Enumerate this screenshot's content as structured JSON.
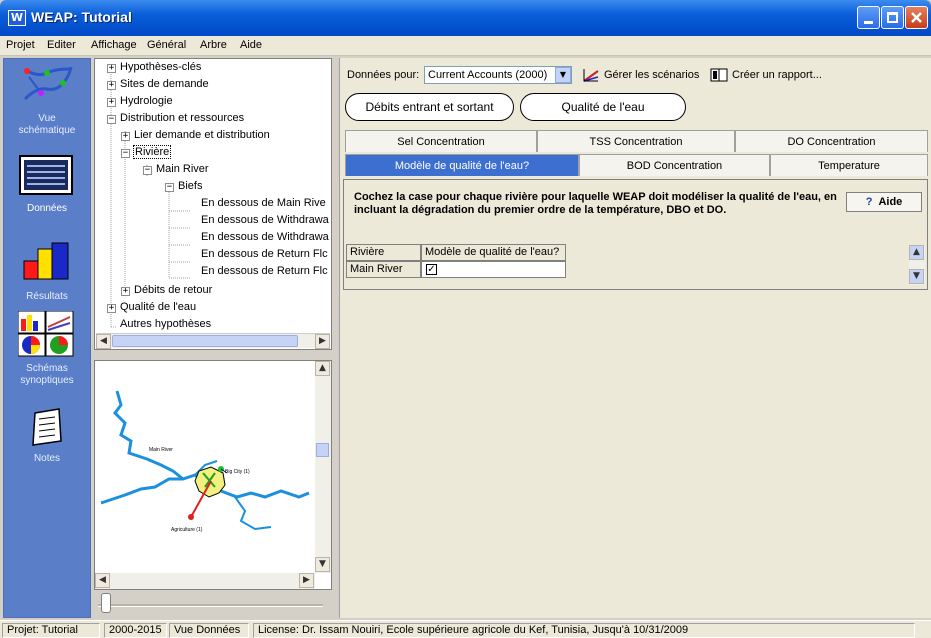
{
  "window": {
    "title": "WEAP: Tutorial",
    "app_icon": "W"
  },
  "menu": [
    "Projet",
    "Editer",
    "Affichage",
    "Général",
    "Arbre",
    "Aide"
  ],
  "leftnav": {
    "items": [
      {
        "label": "Vue\nschématique",
        "icon": "schematic-icon"
      },
      {
        "label": "Données",
        "icon": "data-icon"
      },
      {
        "label": "Résultats",
        "icon": "results-icon"
      },
      {
        "label": "Schémas\nsynoptiques",
        "icon": "overviews-icon"
      },
      {
        "label": "Notes",
        "icon": "notes-icon"
      }
    ]
  },
  "tree": {
    "items": [
      {
        "label": "Hypothèses-clés",
        "level": 0,
        "toggle": "+"
      },
      {
        "label": "Sites de demande",
        "level": 0,
        "toggle": "+"
      },
      {
        "label": "Hydrologie",
        "level": 0,
        "toggle": "+"
      },
      {
        "label": "Distribution et ressources",
        "level": 0,
        "toggle": "-"
      },
      {
        "label": "Lier demande et distribution",
        "level": 1,
        "toggle": "+"
      },
      {
        "label": "Rivière",
        "level": 1,
        "toggle": "-",
        "selected": true
      },
      {
        "label": "Main River",
        "level": 2,
        "toggle": "-"
      },
      {
        "label": "Biefs",
        "level": 3,
        "toggle": "-"
      },
      {
        "label": "En dessous de Main Rive",
        "level": 4
      },
      {
        "label": "En dessous de Withdrawa",
        "level": 4
      },
      {
        "label": "En dessous de Withdrawa",
        "level": 4
      },
      {
        "label": "En dessous de Return Flc",
        "level": 4
      },
      {
        "label": "En dessous de Return Flc",
        "level": 4
      },
      {
        "label": "Débits de retour",
        "level": 1,
        "toggle": "+"
      },
      {
        "label": "Qualité de l'eau",
        "level": 0,
        "toggle": "+"
      },
      {
        "label": "Autres hypothèses",
        "level": 0
      }
    ]
  },
  "map": {
    "labels": [
      "Main River",
      "Big City (1)",
      "Agriculture (1)"
    ]
  },
  "toolbar": {
    "data_for_label": "Données pour:",
    "scenario": "Current Accounts (2000)",
    "manage_scenarios": "Gérer les scénarios",
    "create_report": "Créer un rapport..."
  },
  "pills": [
    "Débits entrant et sortant",
    "Qualité de l'eau"
  ],
  "tabs_top": [
    "Sel Concentration",
    "TSS Concentration",
    "DO Concentration"
  ],
  "tabs_bottom": [
    "Modèle de qualité de l'eau?",
    "BOD Concentration",
    "Temperature"
  ],
  "help": {
    "text": "Cochez la case pour chaque rivière pour laquelle WEAP doit modéliser la qualité de l'eau, en incluant la dégradation du premier ordre de la température, DBO et DO.",
    "button": "Aide"
  },
  "grid": {
    "headers": [
      "Rivière",
      "Modèle de qualité de l'eau?"
    ],
    "rows": [
      {
        "river": "Main River",
        "checked": true
      }
    ]
  },
  "status": {
    "project": "Projet: Tutorial",
    "years": "2000-2015",
    "view": "Vue Données",
    "license": "License: Dr. Issam Nouiri, Ecole supérieure agricole du Kef, Tunisia, Jusqu'à 10/31/2009"
  },
  "colors": {
    "accent": "#3c6fd0",
    "nav_bg": "#5a7ec8",
    "titlebar": "#0a5ed8"
  }
}
